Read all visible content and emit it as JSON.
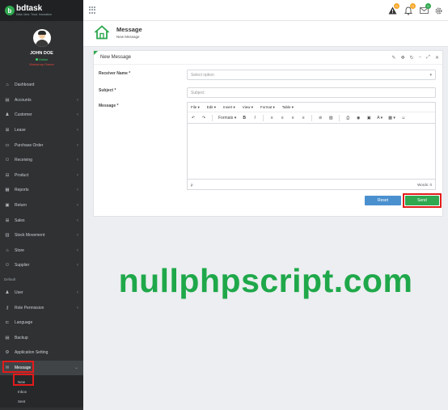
{
  "brand": {
    "name": "bdtask",
    "tagline": "Data. Idea. Trust. Innovation",
    "logo_letter": "b"
  },
  "profile": {
    "name": "JOHN DOE",
    "status": "Online",
    "role": "Workshop Owner"
  },
  "sidebar": {
    "items": [
      {
        "label": "Dashboard",
        "icon": "dashboard-icon",
        "glyph": "⌂",
        "chevron": false
      },
      {
        "label": "Accounts",
        "icon": "money-icon",
        "glyph": "▤",
        "chevron": true
      },
      {
        "label": "Customer",
        "icon": "user-icon",
        "glyph": "♟",
        "chevron": true
      },
      {
        "label": "Lease",
        "icon": "cart-icon",
        "glyph": "⊞",
        "chevron": true
      },
      {
        "label": "Purchase Order",
        "icon": "truck-icon",
        "glyph": "▭",
        "chevron": true
      },
      {
        "label": "Receiving",
        "icon": "handshake-icon",
        "glyph": "⚇",
        "chevron": true
      },
      {
        "label": "Product",
        "icon": "shopping-bag-icon",
        "glyph": "⊟",
        "chevron": true
      },
      {
        "label": "Reports",
        "icon": "calendar-icon",
        "glyph": "▦",
        "chevron": true
      },
      {
        "label": "Return",
        "icon": "return-box-icon",
        "glyph": "▣",
        "chevron": true
      },
      {
        "label": "Sales",
        "icon": "cart-icon",
        "glyph": "⊞",
        "chevron": true
      },
      {
        "label": "Stock Movement",
        "icon": "stock-icon",
        "glyph": "▥",
        "chevron": true
      },
      {
        "label": "Store",
        "icon": "store-icon",
        "glyph": "⌂",
        "chevron": true
      },
      {
        "label": "Supplier",
        "icon": "handshake-icon",
        "glyph": "⚇",
        "chevron": true
      }
    ],
    "heading": "Default",
    "default_items": [
      {
        "label": "User",
        "icon": "users-icon",
        "glyph": "♟",
        "chevron": true
      },
      {
        "label": "Role Permission",
        "icon": "key-icon",
        "glyph": "⚷",
        "chevron": true
      },
      {
        "label": "Language",
        "icon": "language-icon",
        "glyph": "⊏",
        "chevron": false
      },
      {
        "label": "Backup",
        "icon": "database-icon",
        "glyph": "▤",
        "chevron": false
      },
      {
        "label": "Application Setting",
        "icon": "gear-icon",
        "glyph": "⚙",
        "chevron": false
      }
    ],
    "active": {
      "label": "Message",
      "icon": "message-icon",
      "glyph": "✉",
      "chevron": "⌄"
    },
    "submenu": [
      "New",
      "Inbox",
      "Sent"
    ]
  },
  "topbar": {
    "warning_badge": "0",
    "bell_badge": "0",
    "mail_badge": "0"
  },
  "page_header": {
    "title": "Message",
    "subtitle": "New Message"
  },
  "panel": {
    "title": "New Message",
    "tool_glyphs": [
      "✎",
      "✥",
      "↻",
      "−",
      "⤢",
      "✕"
    ]
  },
  "form": {
    "receiver_label": "Receiver Name *",
    "receiver_placeholder": "Select option",
    "subject_label": "Subject *",
    "subject_placeholder": "Subject",
    "message_label": "Message *"
  },
  "editor": {
    "menus": [
      "File ▾",
      "Edit ▾",
      "Insert ▾",
      "View ▾",
      "Format ▾",
      "Table ▾"
    ],
    "formats": "Formats ▾",
    "status_path": "p",
    "word_count": "Words: 0"
  },
  "buttons": {
    "reset": "Reset",
    "send": "Send"
  },
  "watermark": "nullphpscript.com",
  "colors": {
    "accent_green": "#2fa84f",
    "reset_blue": "#4a90cf",
    "highlight_red": "#e31b1b",
    "watermark_green": "#1fa84a"
  }
}
